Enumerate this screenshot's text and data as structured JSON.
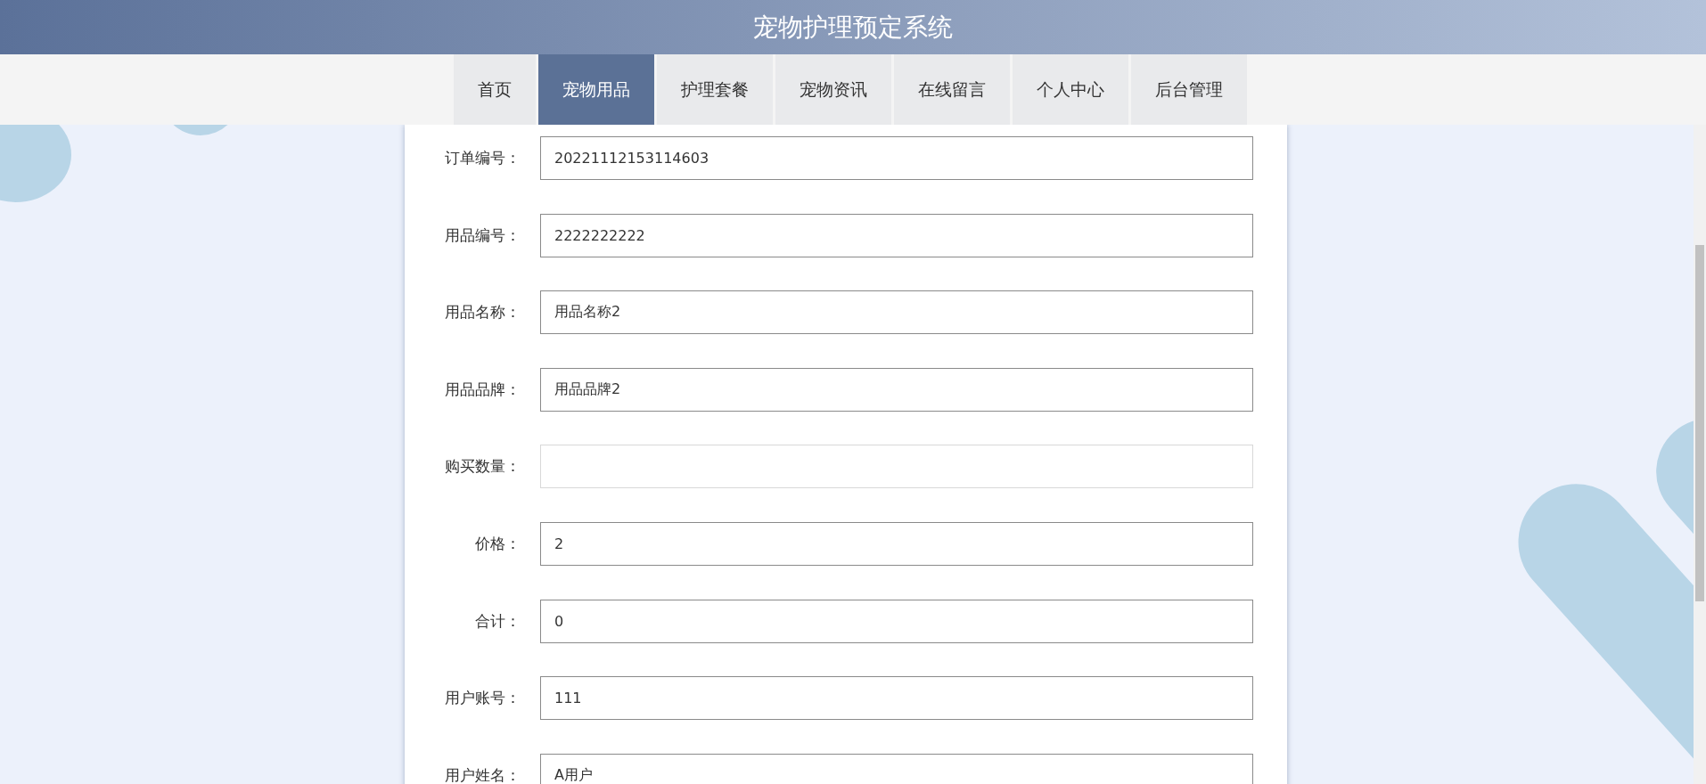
{
  "header": {
    "title": "宠物护理预定系统"
  },
  "nav": [
    {
      "label": "首页",
      "selected": false
    },
    {
      "label": "宠物用品",
      "selected": true
    },
    {
      "label": "护理套餐",
      "selected": false
    },
    {
      "label": "宠物资讯",
      "selected": false
    },
    {
      "label": "在线留言",
      "selected": false
    },
    {
      "label": "个人中心",
      "selected": false
    },
    {
      "label": "后台管理",
      "selected": false
    }
  ],
  "form": [
    {
      "label": "订单编号：",
      "value": "20221112153114603",
      "editable": false
    },
    {
      "label": "用品编号：",
      "value": "2222222222",
      "editable": false
    },
    {
      "label": "用品名称：",
      "value": "用品名称2",
      "editable": false
    },
    {
      "label": "用品品牌：",
      "value": "用品品牌2",
      "editable": false
    },
    {
      "label": "购买数量：",
      "editable": true
    },
    {
      "label": "价格：",
      "value": "2",
      "editable": false
    },
    {
      "label": "合计：",
      "value": "0",
      "editable": false
    },
    {
      "label": "用户账号：",
      "value": "111",
      "editable": false
    },
    {
      "label": "用户姓名：",
      "value": "A用户",
      "editable": false
    }
  ]
}
